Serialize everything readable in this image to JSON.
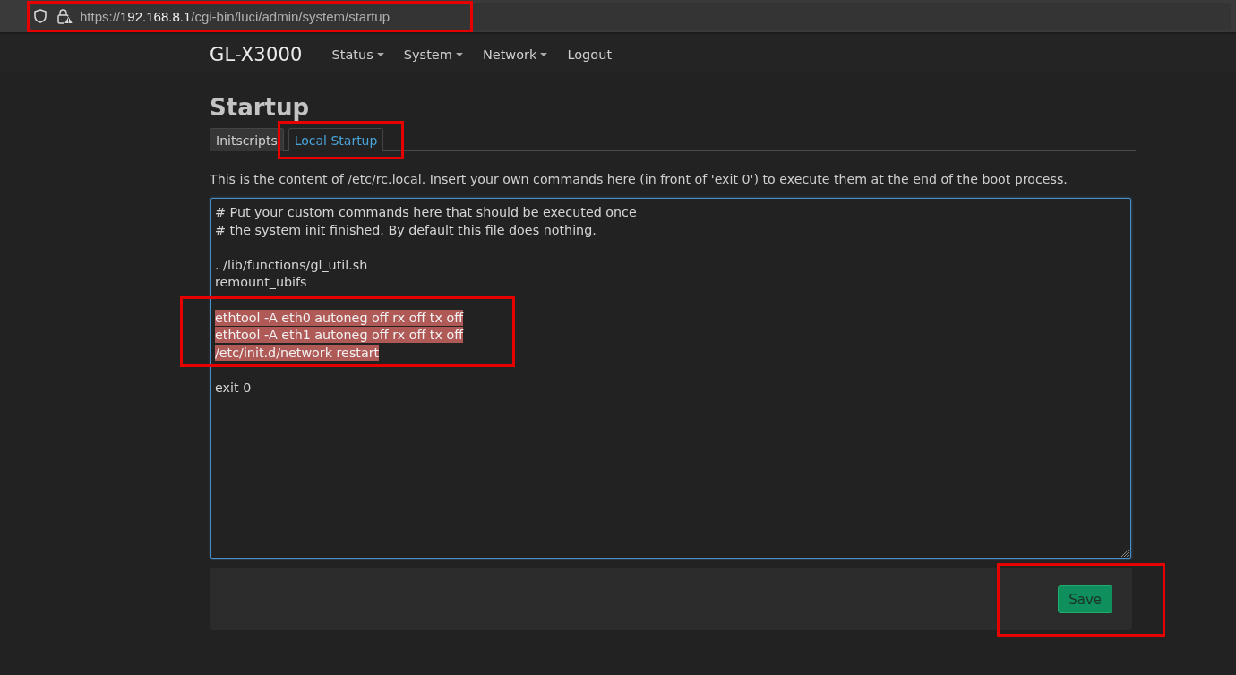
{
  "browser": {
    "address_bar": {
      "scheme": "https://",
      "host": "192.168.8.1",
      "path": "/cgi-bin/luci/admin/system/startup",
      "annotated": true
    }
  },
  "header": {
    "brand": "GL-X3000",
    "menu": [
      {
        "label": "Status",
        "dropdown": true
      },
      {
        "label": "System",
        "dropdown": true
      },
      {
        "label": "Network",
        "dropdown": true
      },
      {
        "label": "Logout",
        "dropdown": false
      }
    ]
  },
  "page": {
    "title": "Startup",
    "tabs": [
      {
        "label": "Initscripts",
        "selected": false,
        "annotated": false
      },
      {
        "label": "Local Startup",
        "selected": true,
        "annotated": true
      }
    ],
    "description": "This is the content of /etc/rc.local. Insert your own commands here (in front of 'exit 0') to execute them at the end of the boot process.",
    "editor": {
      "blocks": [
        {
          "lines": [
            "# Put your custom commands here that should be executed once",
            "# the system init finished. By default this file does nothing."
          ],
          "selected": false,
          "annotated": false
        },
        {
          "lines": [
            ". /lib/functions/gl_util.sh",
            "remount_ubifs"
          ],
          "selected": false,
          "annotated": false
        },
        {
          "lines": [
            "ethtool -A eth0 autoneg off rx off tx off",
            "ethtool -A eth1 autoneg off rx off tx off",
            "/etc/init.d/network restart"
          ],
          "selected": true,
          "annotated": true
        },
        {
          "lines": [
            "exit 0"
          ],
          "selected": false,
          "annotated": false
        }
      ]
    },
    "actions": {
      "save_button": {
        "label": "Save",
        "annotated": true
      }
    }
  }
}
